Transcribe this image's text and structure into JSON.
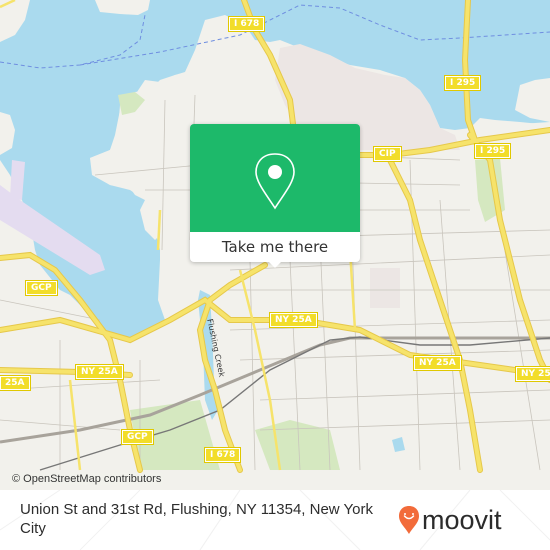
{
  "map": {
    "colors": {
      "water": "#aadaee",
      "land": "#f2f1ec",
      "park": "#d5e8c0",
      "highway": "#f6e36b",
      "highway_casing": "#e6c84a",
      "street": "#c9c5bd",
      "rail": "#8b8b8b",
      "ferry": "#6f8ee0",
      "airport": "#e4dcf0",
      "industrial": "#ece6e4"
    },
    "shields": [
      {
        "label": "I 678"
      },
      {
        "label": "I 295"
      },
      {
        "label": "CIP"
      },
      {
        "label": "I 295"
      },
      {
        "label": "GCP"
      },
      {
        "label": "NY 25A"
      },
      {
        "label": "NY 25A"
      },
      {
        "label": "NY 25A"
      },
      {
        "label": "25A"
      },
      {
        "label": "NY 25A"
      },
      {
        "label": "NY 25"
      },
      {
        "label": "GCP"
      },
      {
        "label": "I 678"
      }
    ],
    "water_label": "Flushing Creek",
    "attribution": "© OpenStreetMap contributors"
  },
  "popup": {
    "icon": "map-pin-icon",
    "button_label": "Take me there",
    "accent_color": "#1db96a"
  },
  "footer": {
    "address": "Union St and 31st Rd, Flushing, NY 11354, New York City",
    "brand": "moovit",
    "brand_color": "#f26b3a"
  }
}
